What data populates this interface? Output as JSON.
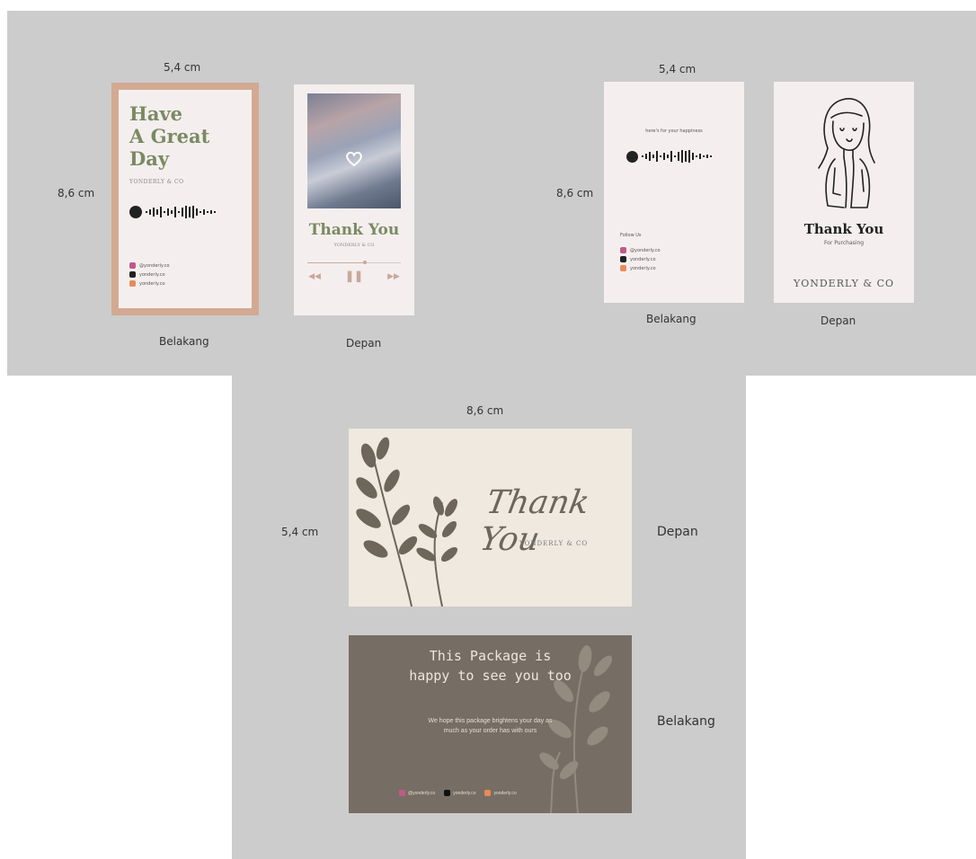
{
  "panel1": {
    "width_label": "5,4 cm",
    "height_label": "8,6 cm",
    "back_caption": "Belakang",
    "front_caption": "Depan",
    "back_card": {
      "title_line1": "Have",
      "title_line2": "A Great",
      "title_line3": "Day",
      "brand": "YONDERLY & CO",
      "socials": [
        "@yonderly.co",
        "yonderly.co",
        "yonderly.co"
      ]
    },
    "front_card": {
      "title": "Thank You",
      "brand": "YONDERLY & CO"
    }
  },
  "panel2": {
    "width_label": "5,4 cm",
    "height_label": "8,6 cm",
    "back_caption": "Belakang",
    "front_caption": "Depan",
    "back_card": {
      "tagline": "here's for your happiness",
      "follow": "Follow Us",
      "socials": [
        "@yonderly.co",
        "yonderly.co",
        "yonderly.co"
      ]
    },
    "front_card": {
      "title": "Thank You",
      "subtitle": "For Purchasing",
      "brand": "YONDERLY & CO"
    }
  },
  "panel3": {
    "width_label": "8,6 cm",
    "height_label": "5,4 cm",
    "front_caption": "Depan",
    "back_caption": "Belakang",
    "front_card": {
      "title": "Thank You",
      "brand": "YONDERLY & CO"
    },
    "back_card": {
      "headline1": "This Package is",
      "headline2": "happy to see you too",
      "body1": "We hope this package brightens your day as",
      "body2": "much as your order has with ours",
      "socials": [
        "@yonderly.co",
        "yonderly.co",
        "yonderly.co"
      ]
    }
  },
  "colors": {
    "panel_bg": "#cccccc",
    "card_bg": "#f4efee",
    "border_tan": "#d3a992",
    "sage": "#7a8a63",
    "brown_card": "#766e64",
    "cream": "#efe9df",
    "leaf": "#6e655b"
  }
}
